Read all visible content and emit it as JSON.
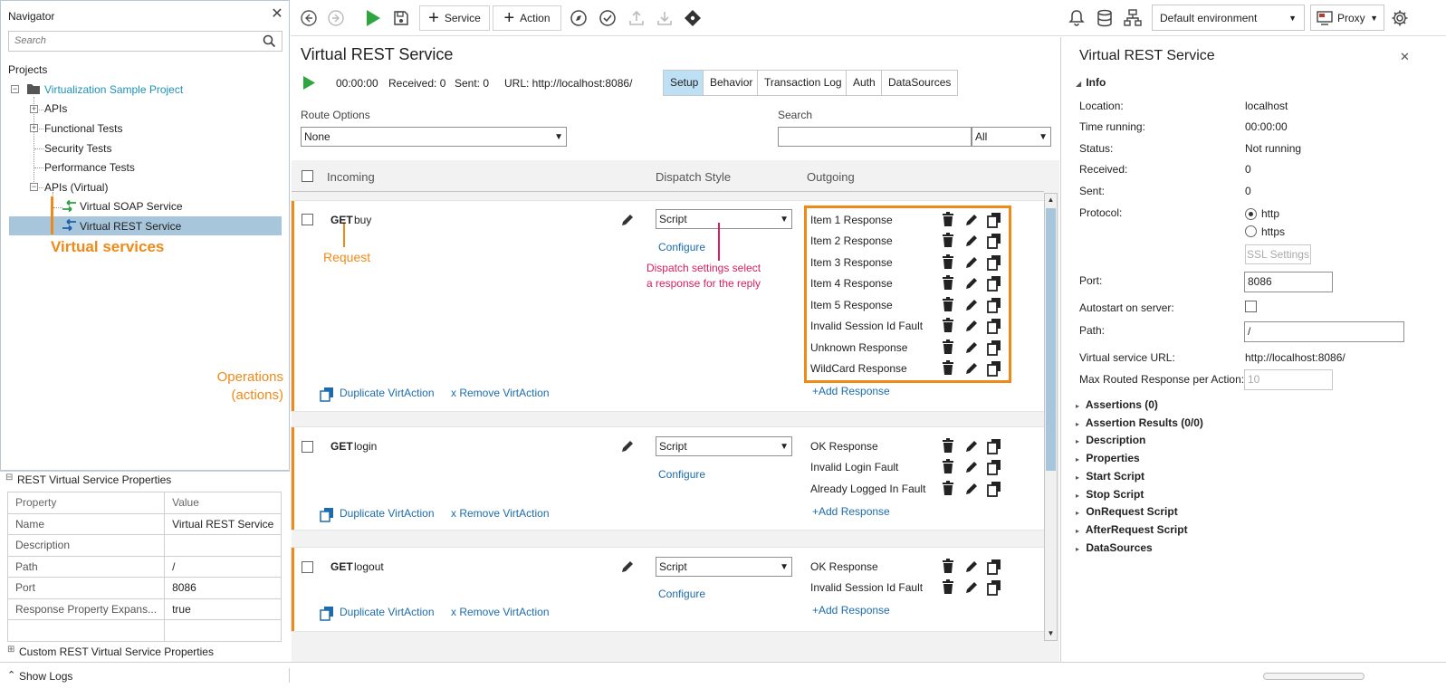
{
  "navigator": {
    "title": "Navigator",
    "search_placeholder": "Search",
    "projects_label": "Projects",
    "project_name": "Virtualization Sample Project",
    "items": [
      "APIs",
      "Functional Tests",
      "Security Tests",
      "Performance Tests",
      "APIs (Virtual)"
    ],
    "virtual_services": [
      "Virtual SOAP Service",
      "Virtual REST Service"
    ]
  },
  "annotations": {
    "virtual_services": "Virtual services",
    "request": "Request",
    "dispatch_line1": "Dispatch settings select",
    "dispatch_line2": "a response for the reply",
    "operations_line1": "Operations",
    "operations_line2": "(actions)"
  },
  "properties_panel": {
    "title": "REST Virtual Service Properties",
    "header_property": "Property",
    "header_value": "Value",
    "rows": [
      {
        "key": "Name",
        "value": "Virtual REST Service"
      },
      {
        "key": "Description",
        "value": ""
      },
      {
        "key": "Path",
        "value": "/"
      },
      {
        "key": "Port",
        "value": "8086"
      },
      {
        "key": "Response Property Expans...",
        "value": "true"
      }
    ],
    "custom_title": "Custom REST Virtual Service Properties"
  },
  "toolbar": {
    "service_label": "Service",
    "action_label": "Action",
    "environment": "Default environment",
    "proxy": "Proxy"
  },
  "editor": {
    "title": "Virtual REST Service",
    "time": "00:00:00",
    "received": "Received: 0",
    "sent": "Sent: 0",
    "url": "URL: http://localhost:8086/",
    "tabs": [
      "Setup",
      "Behavior",
      "Transaction Log",
      "Auth",
      "DataSources"
    ],
    "route_options_label": "Route Options",
    "route_options_value": "None",
    "search_label": "Search",
    "search_value": "",
    "search_filter": "All",
    "col_incoming": "Incoming",
    "col_dispatch": "Dispatch Style",
    "col_outgoing": "Outgoing",
    "duplicate_label": "Duplicate VirtAction",
    "remove_label": "x Remove VirtAction",
    "configure_label": "Configure",
    "add_response_label": "+Add Response",
    "operations": [
      {
        "method": "GET",
        "name": "buy",
        "dispatch": "Script",
        "responses": [
          "Item 1 Response",
          "Item 2 Response",
          "Item 3 Response",
          "Item 4 Response",
          "Item 5 Response",
          "Invalid Session Id Fault",
          "Unknown Response",
          "WildCard Response"
        ]
      },
      {
        "method": "GET",
        "name": "login",
        "dispatch": "Script",
        "responses": [
          "OK Response",
          "Invalid Login Fault",
          "Already Logged In Fault"
        ]
      },
      {
        "method": "GET",
        "name": "logout",
        "dispatch": "Script",
        "responses": [
          "OK Response",
          "Invalid Session Id Fault"
        ]
      }
    ]
  },
  "inspector": {
    "title": "Virtual REST Service",
    "info_label": "Info",
    "location_label": "Location:",
    "location": "localhost",
    "time_label": "Time running:",
    "time": "00:00:00",
    "status_label": "Status:",
    "status": "Not running",
    "received_label": "Received:",
    "received": "0",
    "sent_label": "Sent:",
    "sent": "0",
    "protocol_label": "Protocol:",
    "protocol_http": "http",
    "protocol_https": "https",
    "ssl_settings": "SSL Settings",
    "port_label": "Port:",
    "port": "8086",
    "autostart_label": "Autostart on server:",
    "path_label": "Path:",
    "path": "/",
    "url_label": "Virtual service URL:",
    "url": "http://localhost:8086/",
    "max_routed_label": "Max Routed Response per Action:",
    "max_routed": "10",
    "sections": [
      "Assertions (0)",
      "Assertion Results (0/0)",
      "Description",
      "Properties",
      "Start Script",
      "Stop Script",
      "OnRequest Script",
      "AfterRequest Script",
      "DataSources"
    ]
  },
  "bottom": {
    "show_logs": "Show Logs"
  },
  "colors": {
    "accent_orange": "#f08a16",
    "annotation_red": "#d81e5b",
    "link_blue": "#1c6cad",
    "selection": "#a7c6dc",
    "tab_active": "#bde0f5"
  }
}
